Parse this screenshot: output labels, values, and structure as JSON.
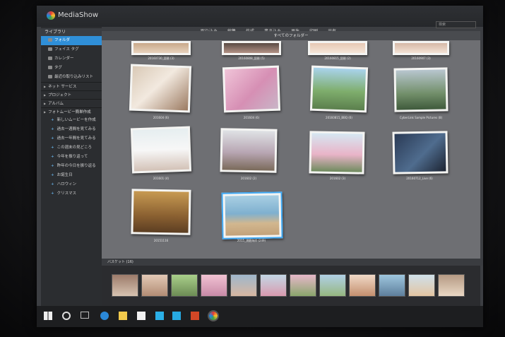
{
  "app": {
    "title": "MediaShow"
  },
  "menu": [
    "取り込み",
    "編集",
    "作成",
    "書き込み",
    "再生",
    "印刷",
    "共有"
  ],
  "sidebar": {
    "library_label": "ライブラリ",
    "items": [
      "フォルダ",
      "フェイス タグ",
      "カレンダー",
      "タグ",
      "最近の取り込みリスト"
    ],
    "sections": [
      "ネット サービス",
      "プロジェクト",
      "アルバム"
    ],
    "movie_section": "フォトムービー簡単作成",
    "movie_items": [
      "新しいムービーを作成",
      "過去一週間を見てみる",
      "過去一年間を見てみる",
      "この週末の見どころ",
      "今年を振り返って",
      "昨年の今日を振り返る",
      "お誕生日",
      "ハロウィン",
      "クリスマス"
    ]
  },
  "content": {
    "folder_label": "すべてのフォルダー",
    "search_placeholder": "検索",
    "captions": [
      "20160730_琵琶 (3)",
      "20160808_琵琶 (5)",
      "20160815_琵琶 (2)",
      "20160907 (3)",
      "201604 (6)",
      "201604 (6)",
      "20160815_BBQ (6)",
      "CyberLink Sample Pictures (8)",
      "201601 (4)",
      "201602 (2)",
      "201602 (3)",
      "20160712_Live (6)",
      "20151116",
      "2015_須磨海岸 (249)"
    ]
  },
  "tray": {
    "label": "バスケット (16)"
  },
  "colors": {
    "accent": "#2f8fd8",
    "sidebar_bg": "#2b2d30",
    "content_bg": "#6e6f73"
  }
}
